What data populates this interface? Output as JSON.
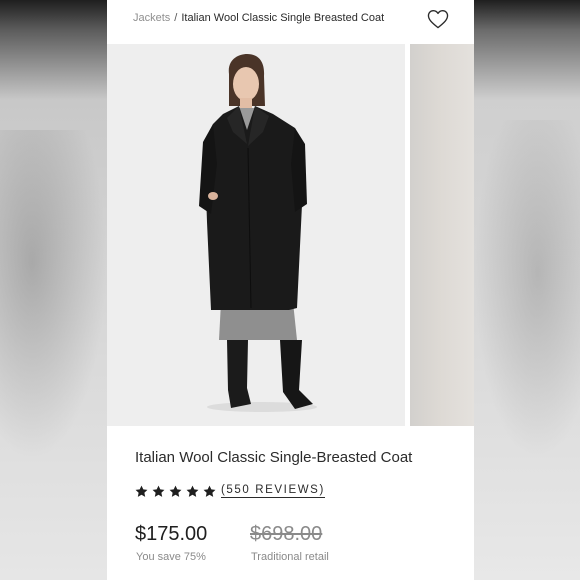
{
  "breadcrumb": {
    "category": "Jackets",
    "separator": "/",
    "current": "Italian Wool Classic Single Breasted Coat"
  },
  "wishlist": {
    "icon": "heart-outline-icon"
  },
  "product": {
    "title": "Italian Wool Classic Single-Breasted Coat",
    "rating": {
      "stars": 5,
      "max": 5,
      "reviews_label": "(550 REVIEWS)"
    },
    "price": "$175.00",
    "savings": "You save 75%",
    "retail_price": "$698.00",
    "retail_label": "Traditional retail"
  },
  "gallery": {
    "images": [
      "model-front-black-coat",
      "next-image-preview"
    ]
  },
  "colors": {
    "text": "#2b2b2b",
    "muted": "#8a8a8a",
    "image_bg": "#eeeeee"
  }
}
